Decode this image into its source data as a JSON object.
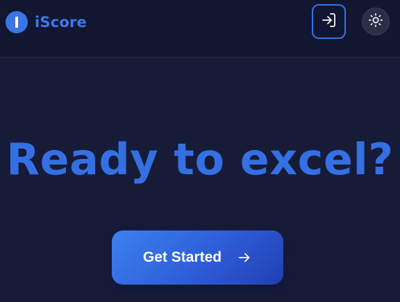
{
  "header": {
    "brand_name": "iScore"
  },
  "hero": {
    "title": "Ready to excel?",
    "cta_label": "Get Started"
  },
  "colors": {
    "accent": "#3470e3",
    "background": "#161b38",
    "header_background": "#111631"
  },
  "icons": {
    "logo": "brand-logo-icon",
    "login": "sign-in-icon",
    "theme": "sun-icon",
    "cta": "arrow-right-icon"
  }
}
